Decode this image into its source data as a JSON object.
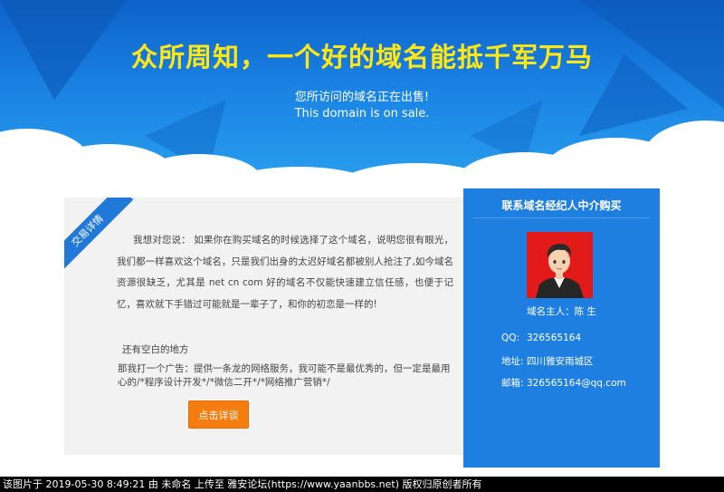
{
  "hero": {
    "title": "众所周知，一个好的域名能抵千军万马",
    "subtitle_cn": "您所访问的域名正在出售!",
    "subtitle_en": "This domain is on sale."
  },
  "left_panel": {
    "ribbon_label": "交易详情",
    "intro": "我想对您说： 如果你在购买域名的时候选择了这个域名，说明您很有眼光，我们都一样喜欢这个域名，只是我们出身的太迟好域名都被别人抢注了,如今域名资源很缺乏，尤其是 net cn com 好的域名不仅能快速建立信任感，也便于记忆，喜欢就下手错过可能就是一辈子了，和你的初恋是一样的!",
    "aside": "还有空白的地方",
    "ad": "那我打一个广告：提供一条龙的网络服务，我可能不是最优秀的，但一定是最用心的/*程序设计开发*/*微信二开*/*网络推广营销*/",
    "detail_button": "点击详谈"
  },
  "right_panel": {
    "title": "联系域名经纪人中介购买",
    "owner": "域名主人：陈 生",
    "qq_label": "QQ:",
    "qq_value": "326565164",
    "address_label": "地址:",
    "address_value": "四川雅安雨城区",
    "email_label": "邮箱:",
    "email_value": "326565164@qq.com"
  },
  "footer": {
    "text": "该图片于 2019-05-30 8:49:21 由 未命名 上传至 雅安论坛(https://www.yaanbbs.net) 版权归原创者所有"
  },
  "colors": {
    "hero_blue": "#1a82e3",
    "title_yellow": "#ffe714",
    "panel_blue": "#1e7fe0",
    "button_orange": "#f57d10",
    "avatar_bg": "#e31a1a"
  },
  "icons": [
    "avatar-illustration"
  ]
}
